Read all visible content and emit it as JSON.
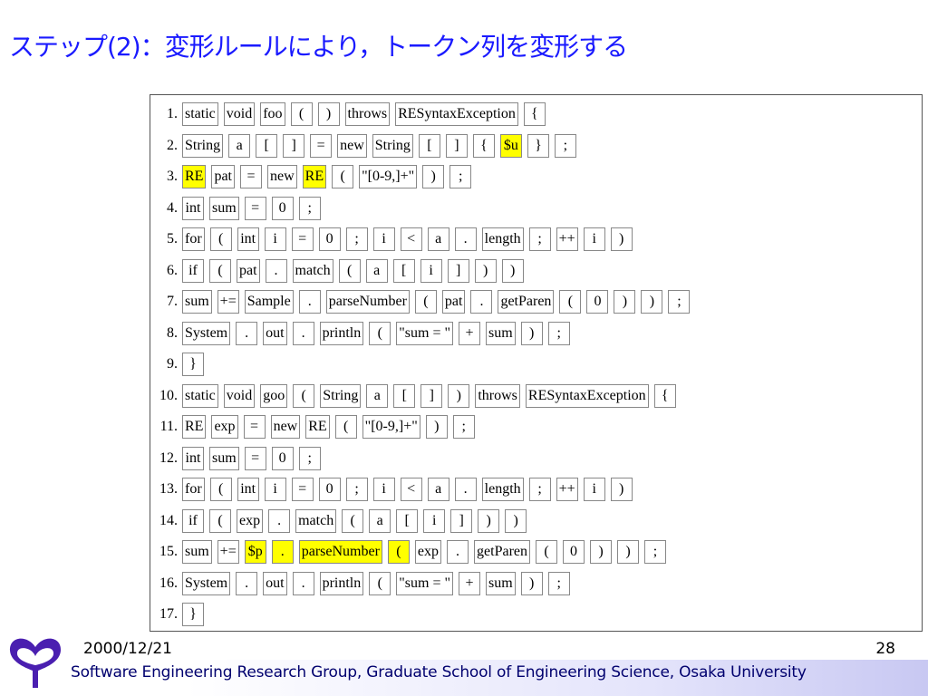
{
  "title": "ステップ(2)：変形ルールにより，トークン列を変形する",
  "code_lines": [
    {
      "num": "1.",
      "tokens": [
        {
          "t": "static"
        },
        {
          "t": "void"
        },
        {
          "t": "foo"
        },
        {
          "t": "("
        },
        {
          "t": ")"
        },
        {
          "t": "throws"
        },
        {
          "t": "RESyntaxException"
        },
        {
          "t": "{"
        }
      ]
    },
    {
      "num": "2.",
      "tokens": [
        {
          "t": "String"
        },
        {
          "t": "a"
        },
        {
          "t": "["
        },
        {
          "t": "]"
        },
        {
          "t": "="
        },
        {
          "t": "new"
        },
        {
          "t": "String"
        },
        {
          "t": "["
        },
        {
          "t": "]"
        },
        {
          "t": "{"
        },
        {
          "t": "$u",
          "hl": true
        },
        {
          "t": "}"
        },
        {
          "t": ";"
        }
      ]
    },
    {
      "num": "3.",
      "tokens": [
        {
          "t": "RE",
          "hl": true
        },
        {
          "t": "pat"
        },
        {
          "t": "="
        },
        {
          "t": "new"
        },
        {
          "t": "RE",
          "hl": true
        },
        {
          "t": "("
        },
        {
          "t": "\"[0-9,]+\""
        },
        {
          "t": ")"
        },
        {
          "t": ";"
        }
      ]
    },
    {
      "num": "4.",
      "tokens": [
        {
          "t": "int"
        },
        {
          "t": "sum"
        },
        {
          "t": "="
        },
        {
          "t": "0"
        },
        {
          "t": ";"
        }
      ]
    },
    {
      "num": "5.",
      "tokens": [
        {
          "t": "for"
        },
        {
          "t": "("
        },
        {
          "t": "int"
        },
        {
          "t": "i"
        },
        {
          "t": "="
        },
        {
          "t": "0"
        },
        {
          "t": ";"
        },
        {
          "t": "i"
        },
        {
          "t": "<"
        },
        {
          "t": "a"
        },
        {
          "t": "."
        },
        {
          "t": "length"
        },
        {
          "t": ";"
        },
        {
          "t": "++"
        },
        {
          "t": "i"
        },
        {
          "t": ")"
        }
      ]
    },
    {
      "num": "6.",
      "tokens": [
        {
          "t": "if"
        },
        {
          "t": "("
        },
        {
          "t": "pat"
        },
        {
          "t": "."
        },
        {
          "t": "match"
        },
        {
          "t": "("
        },
        {
          "t": "a"
        },
        {
          "t": "["
        },
        {
          "t": "i"
        },
        {
          "t": "]"
        },
        {
          "t": ")"
        },
        {
          "t": ")"
        }
      ]
    },
    {
      "num": "7.",
      "tokens": [
        {
          "t": "sum"
        },
        {
          "t": "+="
        },
        {
          "t": "Sample"
        },
        {
          "t": "."
        },
        {
          "t": "parseNumber"
        },
        {
          "t": "("
        },
        {
          "t": "pat"
        },
        {
          "t": "."
        },
        {
          "t": "getParen"
        },
        {
          "t": "("
        },
        {
          "t": "0"
        },
        {
          "t": ")"
        },
        {
          "t": ")"
        },
        {
          "t": ";"
        }
      ]
    },
    {
      "num": "8.",
      "tokens": [
        {
          "t": "System"
        },
        {
          "t": "."
        },
        {
          "t": "out"
        },
        {
          "t": "."
        },
        {
          "t": "println"
        },
        {
          "t": "("
        },
        {
          "t": "\"sum = \""
        },
        {
          "t": "+"
        },
        {
          "t": "sum"
        },
        {
          "t": ")"
        },
        {
          "t": ";"
        }
      ]
    },
    {
      "num": "9.",
      "tokens": [
        {
          "t": "}"
        }
      ]
    },
    {
      "num": "10.",
      "tokens": [
        {
          "t": "static"
        },
        {
          "t": "void"
        },
        {
          "t": "goo"
        },
        {
          "t": "("
        },
        {
          "t": "String"
        },
        {
          "t": "a"
        },
        {
          "t": "["
        },
        {
          "t": "]"
        },
        {
          "t": ")"
        },
        {
          "t": "throws"
        },
        {
          "t": "RESyntaxException"
        },
        {
          "t": "{"
        }
      ]
    },
    {
      "num": "11.",
      "tokens": [
        {
          "t": "RE"
        },
        {
          "t": "exp"
        },
        {
          "t": "="
        },
        {
          "t": "new"
        },
        {
          "t": "RE"
        },
        {
          "t": "("
        },
        {
          "t": "\"[0-9,]+\""
        },
        {
          "t": ")"
        },
        {
          "t": ";"
        }
      ]
    },
    {
      "num": "12.",
      "tokens": [
        {
          "t": "int"
        },
        {
          "t": "sum"
        },
        {
          "t": "="
        },
        {
          "t": "0"
        },
        {
          "t": ";"
        }
      ]
    },
    {
      "num": "13.",
      "tokens": [
        {
          "t": "for"
        },
        {
          "t": "("
        },
        {
          "t": "int"
        },
        {
          "t": "i"
        },
        {
          "t": "="
        },
        {
          "t": "0"
        },
        {
          "t": ";"
        },
        {
          "t": "i"
        },
        {
          "t": "<"
        },
        {
          "t": "a"
        },
        {
          "t": "."
        },
        {
          "t": "length"
        },
        {
          "t": ";"
        },
        {
          "t": "++"
        },
        {
          "t": "i"
        },
        {
          "t": ")"
        }
      ]
    },
    {
      "num": "14.",
      "tokens": [
        {
          "t": "if"
        },
        {
          "t": "("
        },
        {
          "t": "exp"
        },
        {
          "t": "."
        },
        {
          "t": "match"
        },
        {
          "t": "("
        },
        {
          "t": "a"
        },
        {
          "t": "["
        },
        {
          "t": "i"
        },
        {
          "t": "]"
        },
        {
          "t": ")"
        },
        {
          "t": ")"
        }
      ]
    },
    {
      "num": "15.",
      "tokens": [
        {
          "t": "sum"
        },
        {
          "t": "+="
        },
        {
          "t": "$p",
          "hl": true
        },
        {
          "t": ".",
          "hl": true
        },
        {
          "t": "parseNumber",
          "hl": true
        },
        {
          "t": "(",
          "hl": true
        },
        {
          "t": "exp"
        },
        {
          "t": "."
        },
        {
          "t": "getParen"
        },
        {
          "t": "("
        },
        {
          "t": "0"
        },
        {
          "t": ")"
        },
        {
          "t": ")"
        },
        {
          "t": ";"
        }
      ]
    },
    {
      "num": "16.",
      "tokens": [
        {
          "t": "System"
        },
        {
          "t": "."
        },
        {
          "t": "out"
        },
        {
          "t": "."
        },
        {
          "t": "println"
        },
        {
          "t": "("
        },
        {
          "t": "\"sum = \""
        },
        {
          "t": "+"
        },
        {
          "t": "sum"
        },
        {
          "t": ")"
        },
        {
          "t": ";"
        }
      ]
    },
    {
      "num": "17.",
      "tokens": [
        {
          "t": "}"
        }
      ]
    }
  ],
  "footer": {
    "date": "2000/12/21",
    "page": "28",
    "organization": "Software Engineering Research Group, Graduate School of Engineering Science, Osaka University"
  },
  "colors": {
    "title": "#1a1aff",
    "highlight": "#ffff00",
    "logo": "#4a1fb0",
    "footer_text": "#00006e"
  },
  "icons": {
    "logo": "university-logo-icon"
  }
}
